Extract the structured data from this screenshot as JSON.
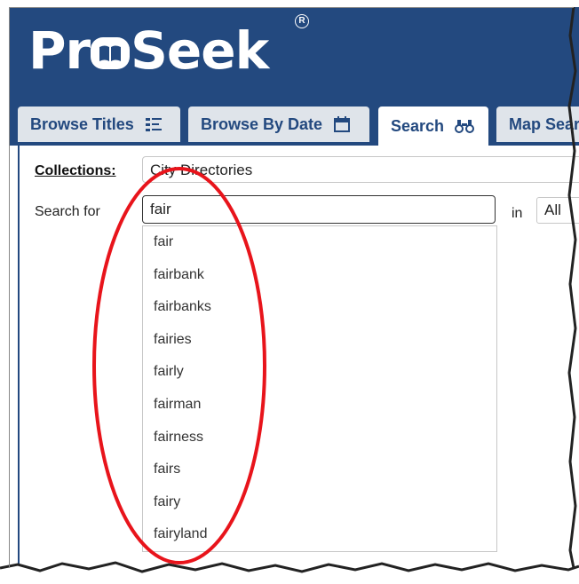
{
  "app": {
    "logo_pre": "Pr",
    "logo_post": "Seek",
    "registered": "R"
  },
  "tabs": [
    {
      "label": "Browse Titles",
      "icon": "list-icon"
    },
    {
      "label": "Browse By Date",
      "icon": "calendar-icon"
    },
    {
      "label": "Search",
      "icon": "binoculars-icon"
    },
    {
      "label": "Map Sear",
      "icon": ""
    }
  ],
  "form": {
    "collections_label": "Collections:",
    "collections_value": "City Directories",
    "search_label": "Search for",
    "search_value": "fair",
    "in_label": "in",
    "in_value": "All"
  },
  "suggestions": [
    "fair",
    "fairbank",
    "fairbanks",
    "fairies",
    "fairly",
    "fairman",
    "fairness",
    "fairs",
    "fairy",
    "fairyland"
  ],
  "colors": {
    "brand": "#23497f",
    "annotation": "#e8141b"
  }
}
